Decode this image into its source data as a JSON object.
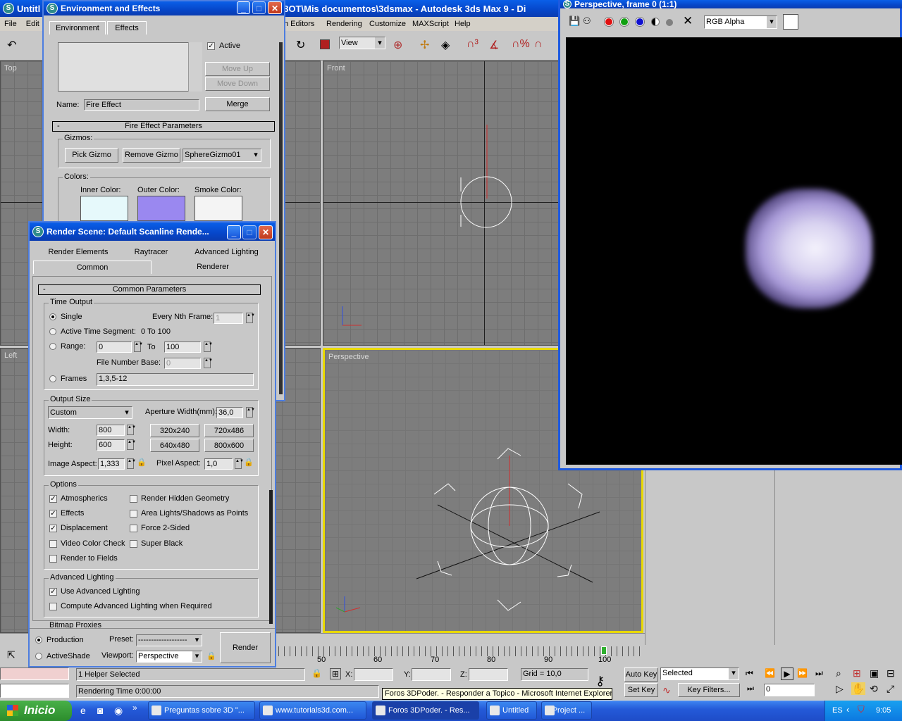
{
  "main_window": {
    "title_left": "Untitl",
    "title_right": "3OT\\Mis documentos\\3dsmax    - Autodesk 3ds Max 9    - Di",
    "menu_left": [
      "File",
      "Edit"
    ],
    "menu_right": [
      "h Editors",
      "Rendering",
      "Customize",
      "MAXScript",
      "Help"
    ],
    "ref_coord": "View"
  },
  "viewports": {
    "top": "Top",
    "front": "Front",
    "left": "Left",
    "perspective": "Perspective"
  },
  "env_dialog": {
    "title": "Environment and Effects",
    "tabs": [
      "Environment",
      "Effects"
    ],
    "active_label": "Active",
    "move_up": "Move Up",
    "move_down": "Move Down",
    "name_label": "Name:",
    "name_value": "Fire Effect",
    "merge": "Merge",
    "rollout": "Fire Effect Parameters",
    "rollout_minus": "-",
    "gizmos_label": "Gizmos:",
    "pick_gizmo": "Pick Gizmo",
    "remove_gizmo": "Remove Gizmo",
    "gizmo_selected": "SphereGizmo01",
    "colors_label": "Colors:",
    "inner_color": "Inner Color:",
    "outer_color": "Outer Color:",
    "smoke_color": "Smoke Color:",
    "inner_hex": "#e6f9fb",
    "outer_hex": "#9a88f0",
    "smoke_hex": "#f4f4f4"
  },
  "render_dialog": {
    "title": "Render Scene: Default Scanline Rende...",
    "tabs_row1": [
      "Render Elements",
      "Raytracer",
      "Advanced Lighting"
    ],
    "tabs_row2": [
      "Common",
      "Renderer"
    ],
    "rollout": "Common Parameters",
    "rollout_minus": "-",
    "time_output": "Time Output",
    "single": "Single",
    "every_nth": "Every Nth Frame:",
    "every_nth_value": "1",
    "active_segment": "Active Time Segment:",
    "active_segment_value": "0 To 100",
    "range": "Range:",
    "range_from": "0",
    "to": "To",
    "range_to": "100",
    "file_number_base": "File Number Base:",
    "file_number_value": "0",
    "frames": "Frames",
    "frames_value": "1,3,5-12",
    "output_size": "Output Size",
    "preset_size": "Custom",
    "aperture": "Aperture Width(mm):",
    "aperture_value": "36,0",
    "width": "Width:",
    "width_value": "800",
    "height": "Height:",
    "height_value": "600",
    "sizes": [
      "320x240",
      "720x486",
      "640x480",
      "800x600"
    ],
    "image_aspect": "Image Aspect:",
    "image_aspect_value": "1,333",
    "pixel_aspect": "Pixel Aspect:",
    "pixel_aspect_value": "1,0",
    "options": "Options",
    "opt_left": [
      {
        "label": "Atmospherics",
        "checked": true
      },
      {
        "label": "Effects",
        "checked": true
      },
      {
        "label": "Displacement",
        "checked": true
      },
      {
        "label": "Video Color Check",
        "checked": false
      },
      {
        "label": "Render to Fields",
        "checked": false
      }
    ],
    "opt_right": [
      {
        "label": "Render Hidden Geometry",
        "checked": false
      },
      {
        "label": "Area Lights/Shadows as Points",
        "checked": false
      },
      {
        "label": "Force 2-Sided",
        "checked": false
      },
      {
        "label": "Super Black",
        "checked": false
      }
    ],
    "adv_lighting": "Advanced Lighting",
    "use_adv": "Use Advanced Lighting",
    "compute_adv": "Compute Advanced Lighting when Required",
    "bitmap_proxies": "Bitmap Proxies",
    "production": "Production",
    "activeshade": "ActiveShade",
    "preset_label": "Preset:",
    "preset_value": "-------------------",
    "viewport_label": "Viewport:",
    "viewport_value": "Perspective",
    "render": "Render"
  },
  "frame_window": {
    "title": "Perspective, frame 0 (1:1)",
    "channel": "RGB Alpha"
  },
  "status": {
    "timeline_labels": [
      "50",
      "60",
      "70",
      "80",
      "90",
      "100"
    ],
    "selection": "1 Helper Selected",
    "render_time": "Rendering Time  0:00:00",
    "x_label": "X:",
    "y_label": "Y:",
    "z_label": "Z:",
    "grid": "Grid = 10,0",
    "auto_key": "Auto Key",
    "set_key": "Set Key",
    "selected": "Selected",
    "key_filters": "Key Filters...",
    "frame": "0",
    "tooltip": "Foros 3DPoder. - Responder a Topico - Microsoft Internet Explorer"
  },
  "taskbar": {
    "start": "Inicio",
    "chevron": "»",
    "items": [
      "Preguntas sobre 3D \"...",
      "www.tutorials3d.com...",
      "Foros 3DPoder. - Res...",
      "Untitled",
      "- Project ..."
    ],
    "lang": "ES",
    "clock": "9:05"
  }
}
